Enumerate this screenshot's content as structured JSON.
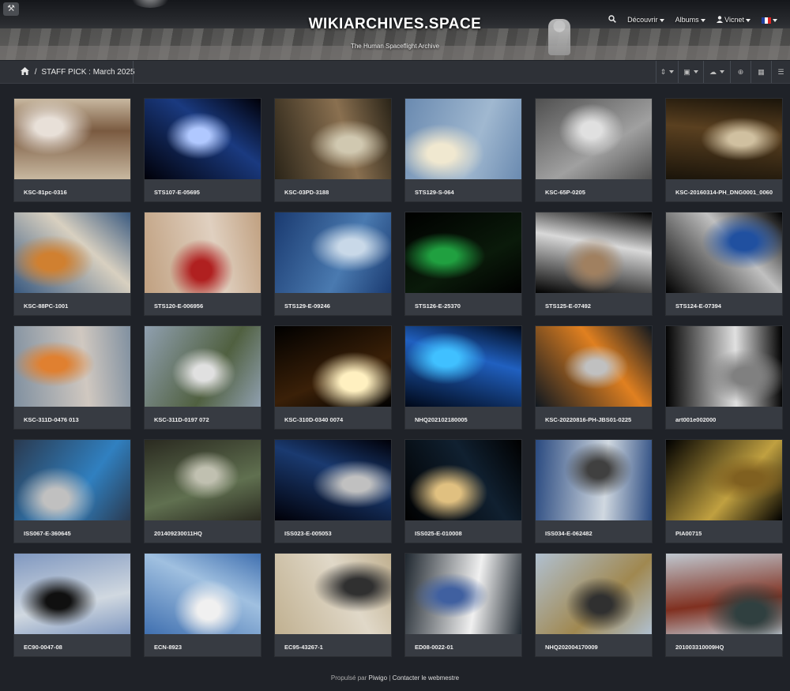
{
  "header": {
    "title": "WIKIARCHIVES.SPACE",
    "subtitle": "The Human Spaceflight Archive",
    "menu": {
      "discover": "Découvrir",
      "albums": "Albums",
      "user": "Vicnet"
    }
  },
  "breadcrumb": {
    "separator": "/",
    "current": "STAFF PICK : March 2025"
  },
  "photos": [
    {
      "title": "KSC-81pc-0316",
      "colors": [
        "#c8b8a0",
        "#7a5a40",
        "#e8e0d8"
      ]
    },
    {
      "title": "STS107-E-05695",
      "colors": [
        "#000008",
        "#1a3a80",
        "#b0c8ff"
      ]
    },
    {
      "title": "KSC-03PD-3188",
      "colors": [
        "#2a2418",
        "#8a7050",
        "#d0c8b0"
      ]
    },
    {
      "title": "STS129-S-064",
      "colors": [
        "#6a8ab0",
        "#a0b8d0",
        "#f0e8d0"
      ]
    },
    {
      "title": "KSC-65P-0205",
      "colors": [
        "#505050",
        "#a0a0a0",
        "#e0e0e0"
      ]
    },
    {
      "title": "KSC-20160314-PH_DNG0001_0060",
      "colors": [
        "#1a140a",
        "#5a4020",
        "#d0c0a0"
      ]
    },
    {
      "title": "KSC-88PC-1001",
      "colors": [
        "#3a5a80",
        "#d8d0c0",
        "#d08030"
      ]
    },
    {
      "title": "STS120-E-006956",
      "colors": [
        "#c0a080",
        "#e0d0c0",
        "#b02020"
      ]
    },
    {
      "title": "STS129-E-09246",
      "colors": [
        "#1a3a70",
        "#4a7ab0",
        "#c8d8e8"
      ]
    },
    {
      "title": "STS126-E-25370",
      "colors": [
        "#000000",
        "#0a1a0a",
        "#20a040"
      ]
    },
    {
      "title": "STS125-E-07492",
      "colors": [
        "#000000",
        "#d8d8d8",
        "#a08060"
      ]
    },
    {
      "title": "STS124-E-07394",
      "colors": [
        "#000000",
        "#c0c0c0",
        "#2050a0"
      ]
    },
    {
      "title": "KSC-311D-0476 013",
      "colors": [
        "#8090a0",
        "#d0c8c0",
        "#e08030"
      ]
    },
    {
      "title": "KSC-311D-0197 072",
      "colors": [
        "#90a0b0",
        "#506040",
        "#e0e0e0"
      ]
    },
    {
      "title": "KSC-310D-0340 0074",
      "colors": [
        "#000000",
        "#3a2008",
        "#fff0c0"
      ]
    },
    {
      "title": "NHQ202102180005",
      "colors": [
        "#000818",
        "#2060c0",
        "#40c0ff"
      ]
    },
    {
      "title": "KSC-20220816-PH-JBS01-0225",
      "colors": [
        "#101820",
        "#e08020",
        "#c0c0c0"
      ]
    },
    {
      "title": "art001e002000",
      "colors": [
        "#000000",
        "#e0e0e0",
        "#808080"
      ]
    },
    {
      "title": "ISS067-E-360645",
      "colors": [
        "#2a3a50",
        "#3080c0",
        "#c0c0c0"
      ]
    },
    {
      "title": "201409230011HQ",
      "colors": [
        "#2a2a20",
        "#607050",
        "#c0c0b0"
      ]
    },
    {
      "title": "ISS023-E-005053",
      "colors": [
        "#000008",
        "#1a3a70",
        "#c0c0c0"
      ]
    },
    {
      "title": "ISS025-E-010008",
      "colors": [
        "#000000",
        "#102030",
        "#e0c080"
      ]
    },
    {
      "title": "ISS034-E-062482",
      "colors": [
        "#2a4a80",
        "#d0d8e0",
        "#404040"
      ]
    },
    {
      "title": "PIA00715",
      "colors": [
        "#000000",
        "#c0a040",
        "#806020"
      ]
    },
    {
      "title": "EC90-0047-08",
      "colors": [
        "#8098c0",
        "#d0d8e0",
        "#101010"
      ]
    },
    {
      "title": "ECN-8923",
      "colors": [
        "#4070b0",
        "#a0c0e0",
        "#f0f0f0"
      ]
    },
    {
      "title": "EC95-43267-1",
      "colors": [
        "#c0b090",
        "#e0d8c8",
        "#303030"
      ]
    },
    {
      "title": "ED08-0022-01",
      "colors": [
        "#202830",
        "#f0f0f0",
        "#4060a0"
      ]
    },
    {
      "title": "NHQ202004170009",
      "colors": [
        "#b0c0d0",
        "#a08850",
        "#303030"
      ]
    },
    {
      "title": "201003310009HQ",
      "colors": [
        "#c0c8d0",
        "#803020",
        "#304040"
      ]
    }
  ],
  "footer": {
    "prefix": "Propulsé par",
    "piwigo": "Piwigo",
    "separator": "|",
    "contact": "Contacter le webmestre"
  }
}
